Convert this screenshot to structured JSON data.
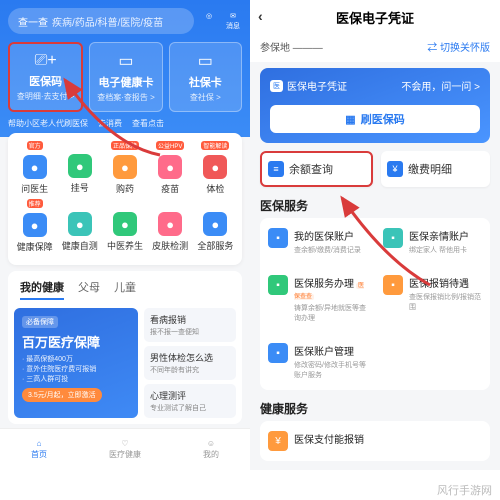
{
  "left": {
    "search": {
      "label": "查一查",
      "placeholder": "疾病/药品/科普/医院/疫苗"
    },
    "msg": "消息",
    "cards": [
      {
        "icon": "⎘",
        "title": "医保码",
        "sub": "查明细·去支付 >"
      },
      {
        "icon": "▭",
        "title": "电子健康卡",
        "sub": "查档案·查报告 >"
      },
      {
        "icon": "▭",
        "title": "社保卡",
        "sub": "查社保 >"
      }
    ],
    "bannerItems": [
      "帮助小区老人代刷医保",
      "去消费",
      "查看点击"
    ],
    "quick1": [
      {
        "label": "问医生",
        "color": "c-blue",
        "badge": "官方"
      },
      {
        "label": "挂号",
        "color": "c-green"
      },
      {
        "label": "购药",
        "color": "c-orange",
        "badge": "正品保障"
      },
      {
        "label": "疫苗",
        "color": "c-pink",
        "badge": "公益HPV"
      },
      {
        "label": "体检",
        "color": "c-red",
        "badge": "智能解读"
      }
    ],
    "quick2": [
      {
        "label": "健康保障",
        "color": "c-blue",
        "badge": "推荐"
      },
      {
        "label": "健康自测",
        "color": "c-teal"
      },
      {
        "label": "中医养生",
        "color": "c-green"
      },
      {
        "label": "皮肤检测",
        "color": "c-pink"
      },
      {
        "label": "全部服务",
        "color": "c-blue"
      }
    ],
    "tabs": [
      "我的健康",
      "父母",
      "儿童"
    ],
    "promo": {
      "tag": "必备保障",
      "title": "百万医疗保障",
      "line1": "· 最高保额400万",
      "line2": "· 意外住院医疗费可报销",
      "line3": "· 三高人群可投",
      "pill": "3.5元/月起，立即激活"
    },
    "side": [
      {
        "t": "看病报销",
        "s": "报不报一查便知"
      },
      {
        "t": "男性体检怎么选",
        "s": "不同年龄有讲究"
      },
      {
        "t": "心理测评",
        "s": "专业测试了解自己"
      }
    ],
    "nav": [
      "首页",
      "医疗健康",
      "我的"
    ]
  },
  "right": {
    "title": "医保电子凭证",
    "insured": "参保地",
    "insuredVal": "———",
    "switch": "⇄ 切换关怀版",
    "card": {
      "label": "医保电子凭证",
      "help": "不会用，问一问 >",
      "qr": "刷医保码"
    },
    "actions": [
      {
        "icon": "≡",
        "label": "余额查询"
      },
      {
        "icon": "¥",
        "label": "缴费明细"
      }
    ],
    "sectA": "医保服务",
    "svcs": [
      {
        "ic": "c-blue",
        "t": "我的医保账户",
        "s": "查余额/缴费/消费记录"
      },
      {
        "ic": "c-teal",
        "t": "医保亲情账户",
        "s": "绑定家人 帮他用卡"
      },
      {
        "ic": "c-green",
        "t": "医保服务办理",
        "s": "铸算余额/异地就医等查询办理",
        "tag": "医保查查"
      },
      {
        "ic": "c-orange",
        "t": "医保报销待遇",
        "s": "查医保报销比例/报销范围"
      },
      {
        "ic": "c-blue",
        "t": "医保账户管理",
        "s": "修改密码/修改手机号等账户服务"
      }
    ],
    "sectB": "健康服务",
    "svcB": {
      "t": "医保支付能报销"
    }
  },
  "watermark": "风行手游网"
}
